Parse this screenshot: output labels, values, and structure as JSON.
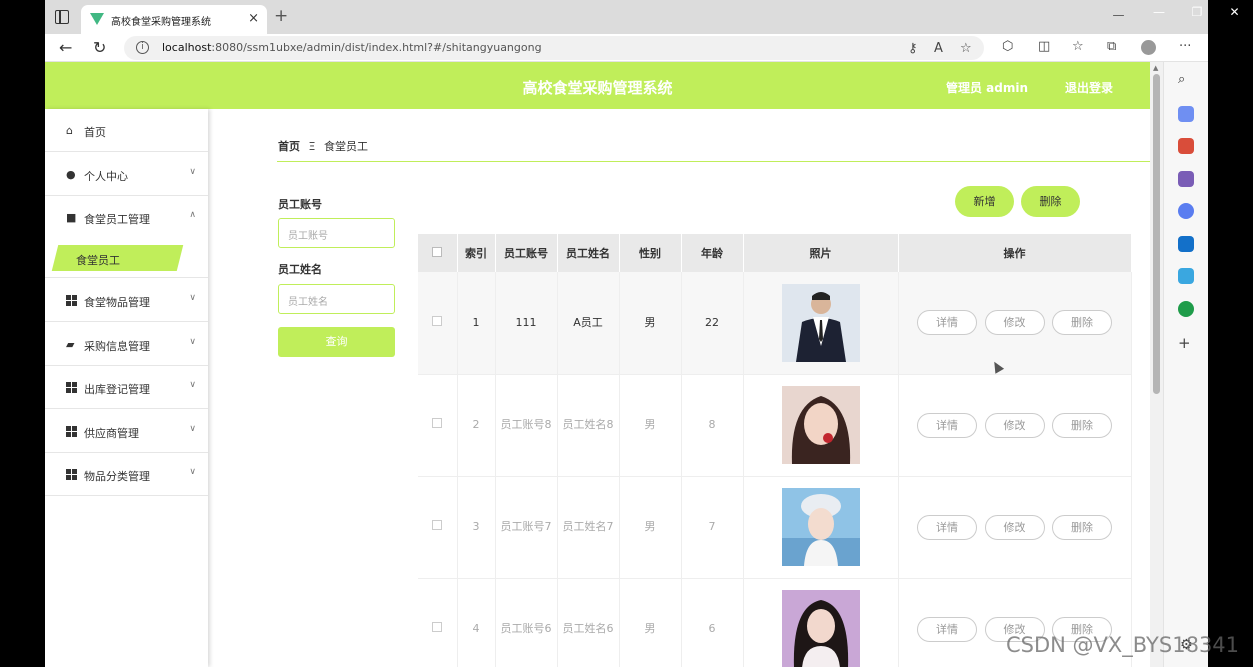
{
  "browser": {
    "tab_title": "高校食堂采购管理系统",
    "tab_close": "×",
    "new_tab": "+",
    "url_host": "localhost",
    "url_rest": ":8080/ssm1ubxe/admin/dist/index.html?#/shitangyuangong",
    "window_controls": [
      "—",
      "❐",
      "✕"
    ],
    "icons": [
      "back-icon",
      "refresh-icon",
      "info-icon",
      "key-icon",
      "read-aloud-icon",
      "favorite-icon",
      "extensions-icon",
      "split-icon",
      "favorites-icon",
      "collections-icon",
      "profile-icon",
      "more-icon"
    ]
  },
  "header": {
    "title": "高校食堂采购管理系统",
    "user": "管理员 admin",
    "logout": "退出登录",
    "accent": "#c0ee5a"
  },
  "menu": {
    "items": [
      {
        "label": "首页",
        "icon": "home-icon"
      },
      {
        "label": "个人中心",
        "icon": "user-icon"
      },
      {
        "label": "食堂员工管理",
        "icon": "briefcase-icon"
      },
      {
        "label": "食堂物品管理",
        "icon": "grid-icon"
      },
      {
        "label": "采购信息管理",
        "icon": "cart-icon"
      },
      {
        "label": "出库登记管理",
        "icon": "grid-icon"
      },
      {
        "label": "供应商管理",
        "icon": "grid-icon"
      },
      {
        "label": "物品分类管理",
        "icon": "grid-icon"
      }
    ],
    "sub_item": "食堂员工"
  },
  "breadcrumb": {
    "home": "首页",
    "sep": "Ξ",
    "current": "食堂员工"
  },
  "search": {
    "account_label": "员工账号",
    "account_placeholder": "员工账号",
    "name_label": "员工姓名",
    "name_placeholder": "员工姓名",
    "button": "查询"
  },
  "actions": {
    "add": "新增",
    "delete": "删除"
  },
  "table": {
    "columns": [
      "",
      "索引",
      "员工账号",
      "员工姓名",
      "性别",
      "年龄",
      "照片",
      "操作"
    ],
    "row_buttons": [
      "详情",
      "修改",
      "删除"
    ],
    "rows": [
      {
        "index": "1",
        "account": "111",
        "name": "A员工",
        "gender": "男",
        "age": "22"
      },
      {
        "index": "2",
        "account": "员工账号8",
        "name": "员工姓名8",
        "gender": "男",
        "age": "8"
      },
      {
        "index": "3",
        "account": "员工账号7",
        "name": "员工姓名7",
        "gender": "男",
        "age": "7"
      },
      {
        "index": "4",
        "account": "员工账号6",
        "name": "员工姓名6",
        "gender": "男",
        "age": "6"
      }
    ]
  },
  "watermark": "CSDN @VX_BYS18341"
}
